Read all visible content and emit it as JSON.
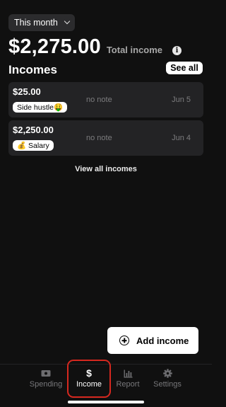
{
  "header": {
    "period": "This month",
    "total_amount": "$2,275.00",
    "total_label": "Total income"
  },
  "incomes": {
    "title": "Incomes",
    "see_all": "See all",
    "items": [
      {
        "amount": "$25.00",
        "tag": "Side hustle🤑",
        "note": "no note",
        "date": "Jun 5"
      },
      {
        "amount": "$2,250.00",
        "tag": "💰 Salary",
        "note": "no note",
        "date": "Jun 4"
      }
    ],
    "view_all": "View all incomes"
  },
  "actions": {
    "add_income": "Add income"
  },
  "tabbar": {
    "tabs": [
      {
        "label": "Spending",
        "icon": "banknote-icon"
      },
      {
        "label": "Income",
        "icon": "dollar-icon",
        "active": true
      },
      {
        "label": "Report",
        "icon": "bar-chart-icon"
      },
      {
        "label": "Settings",
        "icon": "gear-icon"
      }
    ]
  },
  "colors": {
    "background": "#101010",
    "card": "#232325",
    "muted_text": "#7c7c7e",
    "highlight": "#d6281f"
  }
}
